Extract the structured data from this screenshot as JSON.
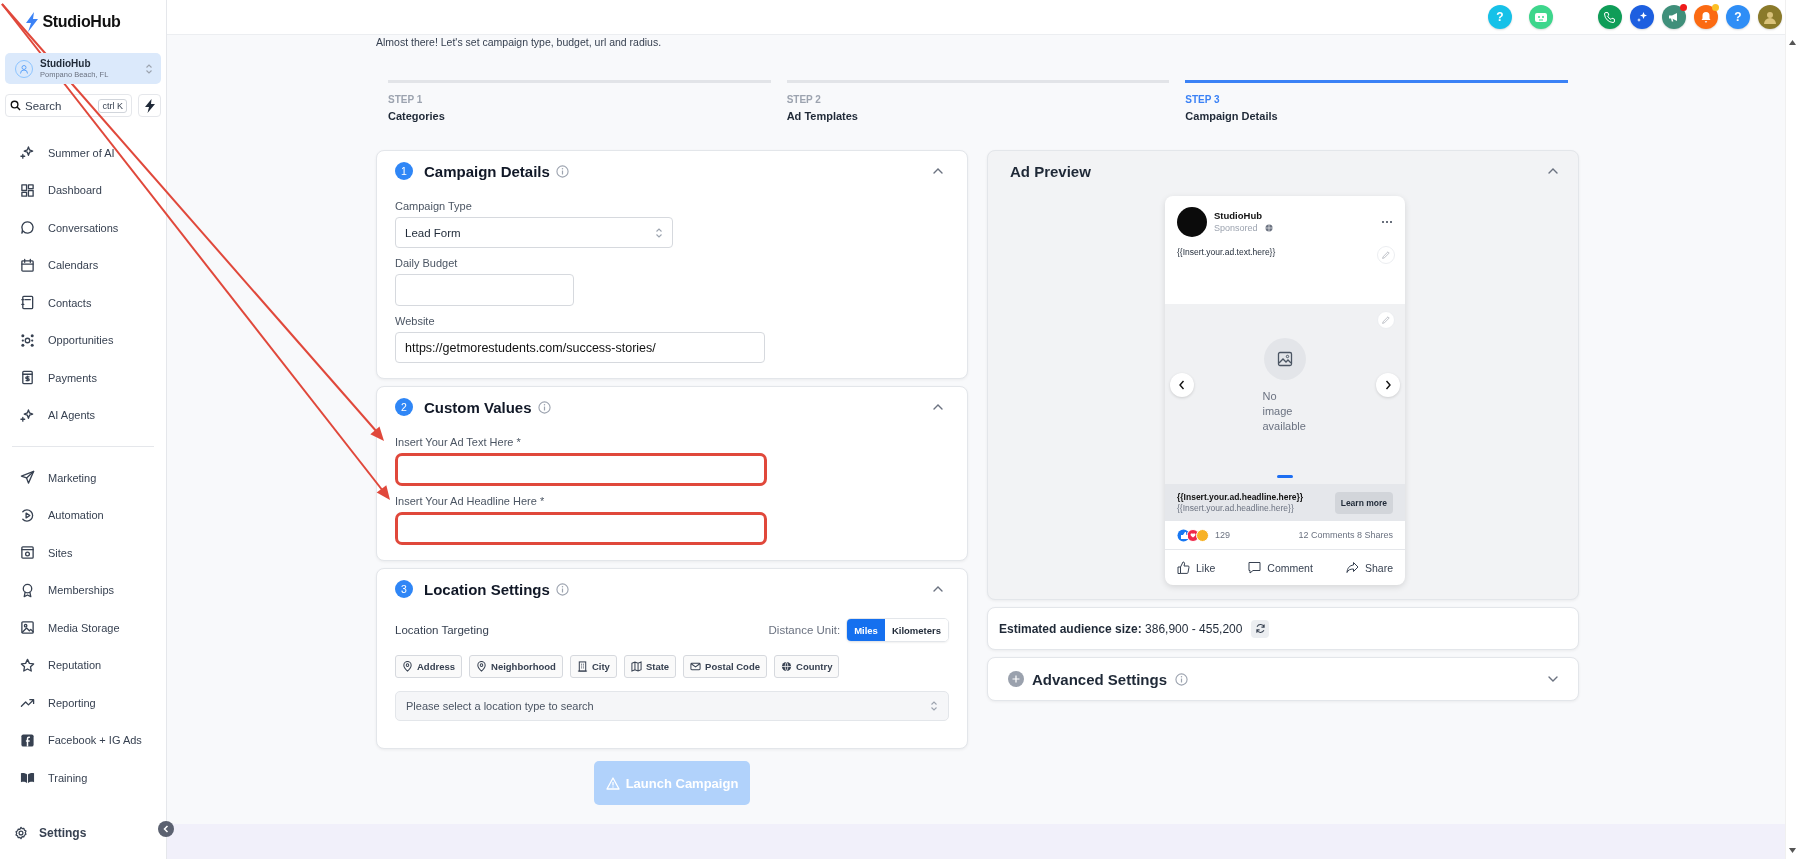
{
  "topbar": {
    "buttons": [
      {
        "kind": "help",
        "label": "?",
        "color": "#16c1e8"
      },
      {
        "kind": "bot",
        "color": "#3dd68c"
      },
      {
        "kind": "phone",
        "color": "#0f9d58"
      },
      {
        "kind": "sparkle",
        "color": "#1d5fe0"
      },
      {
        "kind": "megaphone",
        "color": "#3f8f7a",
        "badge": {
          "color": "#ef1a1a"
        }
      },
      {
        "kind": "bell",
        "color": "#fb6a12",
        "badge": {
          "color": "#fbbf24"
        }
      },
      {
        "kind": "help",
        "label": "?",
        "color": "#2f8ef6"
      },
      {
        "kind": "avatar",
        "color": "#8a7a2a"
      }
    ]
  },
  "sidebar": {
    "logo": "StudioHub",
    "account": {
      "name": "StudioHub",
      "location": "Pompano Beach, FL"
    },
    "search": {
      "placeholder": "Search",
      "shortcut": "ctrl K"
    },
    "groups": [
      [
        "Summer of AI",
        "Dashboard",
        "Conversations",
        "Calendars",
        "Contacts",
        "Opportunities",
        "Payments",
        "AI Agents"
      ],
      [
        "Marketing",
        "Automation",
        "Sites",
        "Memberships",
        "Media Storage",
        "Reputation",
        "Reporting",
        "Facebook + IG Ads",
        "Training"
      ]
    ],
    "settings": "Settings"
  },
  "subtitle": "Almost there! Let's set campaign type, budget, url and radius.",
  "steps": [
    {
      "step": "STEP 1",
      "title": "Categories",
      "selected": false
    },
    {
      "step": "STEP 2",
      "title": "Ad Templates",
      "selected": false
    },
    {
      "step": "STEP 3",
      "title": "Campaign Details",
      "selected": true
    }
  ],
  "sections": [
    {
      "number": "1",
      "title": "Campaign Details",
      "expanded": true,
      "fields": [
        {
          "kind": "select",
          "label": "Campaign Type",
          "value": "Lead Form",
          "annotated": false
        },
        {
          "kind": "text",
          "label": "Daily Budget",
          "annotated": false
        },
        {
          "kind": "url",
          "label": "Website",
          "value": "https://getmorestudents.com/success-stories/",
          "annotated": false
        }
      ]
    },
    {
      "number": "2",
      "title": "Custom Values",
      "expanded": true,
      "fields": [
        {
          "kind": "wide",
          "label": "Insert Your Ad Text Here *",
          "annotated": true
        },
        {
          "kind": "wide",
          "label": "Insert Your Ad Headline Here *",
          "annotated": true
        }
      ]
    },
    {
      "number": "3",
      "title": "Location Settings",
      "expanded": true,
      "location": {
        "targeting_label": "Location Targeting",
        "distance_label": "Distance Unit:",
        "units": [
          {
            "label": "Miles",
            "selected": true
          },
          {
            "label": "Kilometers",
            "selected": false
          }
        ],
        "types": [
          "Address",
          "Neighborhood",
          "City",
          "State",
          "Postal Code",
          "Country"
        ],
        "search": {
          "placeholder": "Please select a location type to search"
        }
      }
    }
  ],
  "launch": {
    "label": "Launch Campaign",
    "disabled": true
  },
  "preview": {
    "title": "Ad Preview",
    "expanded": true,
    "post": {
      "page": "StudioHub",
      "sponsored": "Sponsored",
      "ad_text": "{{Insert.your.ad.text.here}}",
      "no_image": "No image available",
      "headline": "{{Insert.your.ad.headline.here}}",
      "description": "{{Insert.your.ad.headline.here}}",
      "cta": "Learn more",
      "reactions": "129",
      "engagement": "12 Comments 8 Shares",
      "actions": [
        "Like",
        "Comment",
        "Share"
      ]
    }
  },
  "audience": {
    "text": "**Estimated audience size:** 386,900 - 455,200"
  },
  "advanced": {
    "title": "Advanced Settings",
    "expanded": false
  }
}
